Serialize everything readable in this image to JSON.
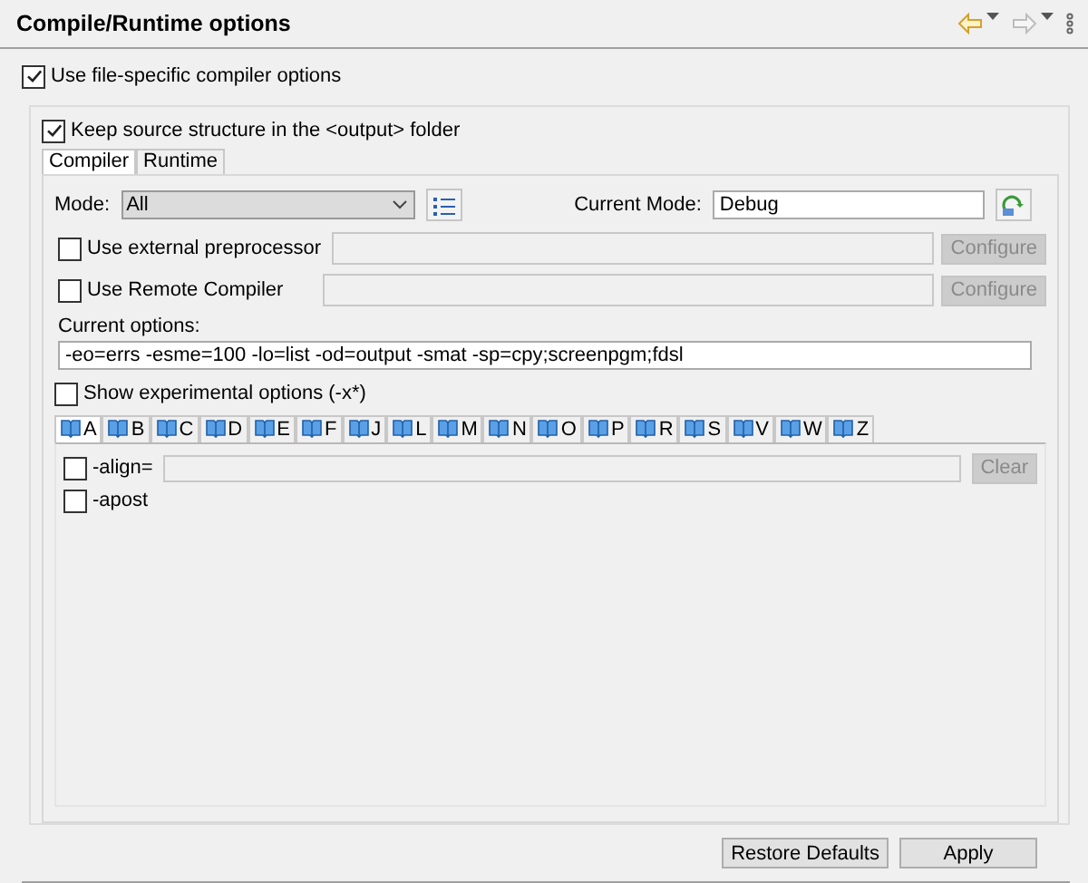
{
  "header": {
    "title": "Compile/Runtime options"
  },
  "navigation": [
    {
      "kind": "back",
      "disabled": false
    },
    {
      "kind": "forward",
      "disabled": true
    }
  ],
  "use_file_specific": {
    "label": "Use file-specific compiler options",
    "checked": true
  },
  "keep_source": {
    "label": "Keep source structure in the <output> folder",
    "checked": true
  },
  "tabs": [
    {
      "label": "Compiler",
      "selected": true
    },
    {
      "label": "Runtime",
      "selected": false
    }
  ],
  "mode": {
    "label": "Mode:",
    "value": "All"
  },
  "current_mode": {
    "label": "Current Mode:",
    "value": "Debug"
  },
  "tools": [
    {
      "label": "Use external preprocessor",
      "checked": false,
      "button": "Configure",
      "disabled": true
    },
    {
      "label": "Use Remote Compiler",
      "checked": false,
      "button": "Configure",
      "disabled": true
    }
  ],
  "current_options": {
    "label": "Current options:",
    "value": "-eo=errs -esme=100 -lo=list -od=output -smat -sp=cpy;screenpgm;fdsl"
  },
  "experimental": {
    "label": "Show experimental options (-x*)",
    "checked": false
  },
  "letter_tabs": [
    {
      "label": "A",
      "selected": true
    },
    {
      "label": "B",
      "selected": false
    },
    {
      "label": "C",
      "selected": false
    },
    {
      "label": "D",
      "selected": false
    },
    {
      "label": "E",
      "selected": false
    },
    {
      "label": "F",
      "selected": false
    },
    {
      "label": "J",
      "selected": false
    },
    {
      "label": "L",
      "selected": false
    },
    {
      "label": "M",
      "selected": false
    },
    {
      "label": "N",
      "selected": false
    },
    {
      "label": "O",
      "selected": false
    },
    {
      "label": "P",
      "selected": false
    },
    {
      "label": "R",
      "selected": false
    },
    {
      "label": "S",
      "selected": false
    },
    {
      "label": "V",
      "selected": false
    },
    {
      "label": "W",
      "selected": false
    },
    {
      "label": "Z",
      "selected": false
    }
  ],
  "options": [
    {
      "kind": "field",
      "label": "-align=",
      "checked": false,
      "button": "Clear",
      "disabled": true
    },
    {
      "kind": "flag",
      "label": "-apost",
      "checked": false
    }
  ],
  "buttons": [
    {
      "label": "Restore Defaults"
    },
    {
      "label": "Apply"
    }
  ]
}
